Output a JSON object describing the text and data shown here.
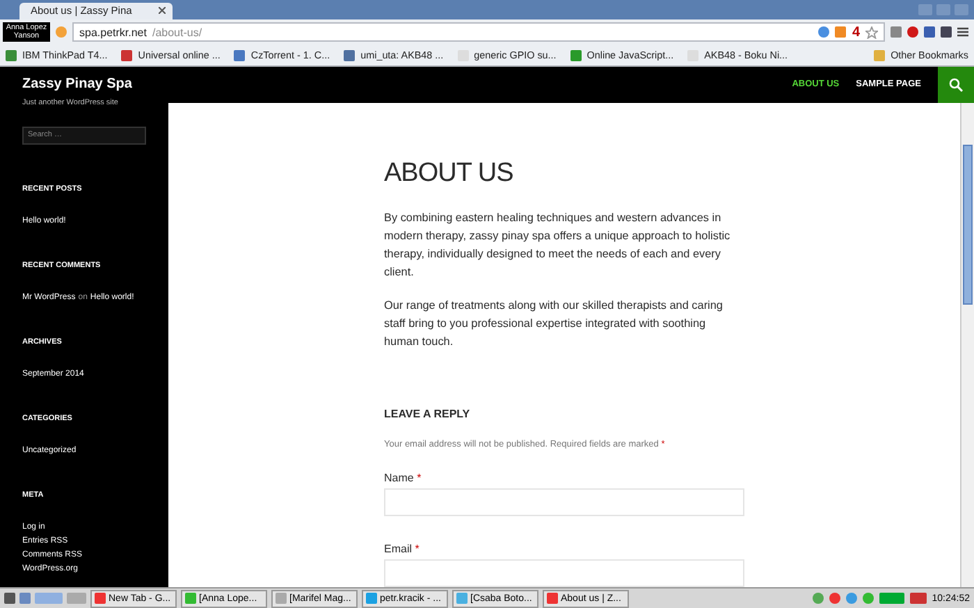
{
  "browser": {
    "tab_title": "About us | Zassy Pina",
    "profile_badge": "Anna Lopez Yanson",
    "address": {
      "host": "spa.petrkr.net",
      "path": "/about-us/"
    },
    "extension_count": "4",
    "bookmarks": [
      "IBM ThinkPad T4...",
      "Universal online ...",
      "CzTorrent - 1. C...",
      "umi_uta: AKB48 ...",
      "generic GPIO su...",
      "Online JavaScript...",
      "AKB48 - Boku Ni..."
    ],
    "other_bookmarks": "Other Bookmarks"
  },
  "site": {
    "title": "Zassy Pinay Spa",
    "tagline": "Just another WordPress site",
    "nav": [
      {
        "label": "ABOUT US",
        "selected": true
      },
      {
        "label": "SAMPLE PAGE",
        "selected": false
      }
    ],
    "search": {
      "placeholder": "Search …"
    },
    "widgets": [
      {
        "heading": "RECENT POSTS",
        "items": [
          {
            "kind": "link",
            "text": "Hello world!"
          }
        ]
      },
      {
        "heading": "RECENT COMMENTS",
        "items": [
          {
            "kind": "comment",
            "author": "Mr WordPress",
            "joiner": "on",
            "post": "Hello world!"
          }
        ]
      },
      {
        "heading": "ARCHIVES",
        "items": [
          {
            "kind": "link",
            "text": "September 2014"
          }
        ]
      },
      {
        "heading": "CATEGORIES",
        "items": [
          {
            "kind": "link",
            "text": "Uncategorized"
          }
        ]
      },
      {
        "heading": "META",
        "items": [
          {
            "kind": "link",
            "text": "Log in"
          },
          {
            "kind": "link",
            "text": "Entries RSS"
          },
          {
            "kind": "link",
            "text": "Comments RSS"
          },
          {
            "kind": "link",
            "text": "WordPress.org"
          }
        ]
      }
    ]
  },
  "article": {
    "title": "ABOUT US",
    "paragraphs": [
      "By combining eastern healing techniques and western advances in modern therapy, zassy pinay spa offers a unique approach to holistic therapy, individually designed to meet the needs of each and every client.",
      "Our range of treatments along with our skilled therapists and caring staff bring to you professional expertise integrated with soothing human touch."
    ],
    "reply": {
      "heading": "LEAVE A REPLY",
      "note": "Your email address will not be published. Required fields are marked",
      "note_mark": "*",
      "fields": [
        {
          "label": "Name",
          "mark": "*"
        },
        {
          "label": "Email",
          "mark": "*"
        }
      ]
    }
  },
  "taskbar": {
    "tasks": [
      "New Tab - G...",
      "[Anna Lope...",
      "[Marifel Mag...",
      "petr.kracik - ...",
      "[Csaba Boto...",
      "About us | Z..."
    ],
    "clock": "10:24:52"
  }
}
